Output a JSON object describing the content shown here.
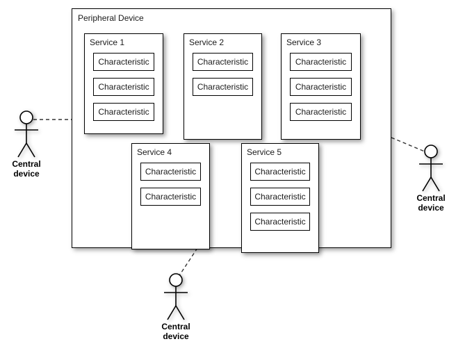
{
  "diagram": {
    "title": "Peripheral Device",
    "peripheral": {
      "label": "Peripheral Device",
      "services": [
        {
          "name": "Service 1",
          "characteristics": [
            "Characteristic",
            "Characteristic",
            "Characteristic"
          ]
        },
        {
          "name": "Service 2",
          "characteristics": [
            "Characteristic",
            "Characteristic"
          ]
        },
        {
          "name": "Service 3",
          "characteristics": [
            "Characteristic",
            "Characteristic",
            "Characteristic"
          ]
        },
        {
          "name": "Service 4",
          "characteristics": [
            "Characteristic",
            "Characteristic"
          ]
        },
        {
          "name": "Service 5",
          "characteristics": [
            "Characteristic",
            "Characteristic",
            "Characteristic"
          ]
        }
      ]
    },
    "actors": [
      {
        "id": "central-device-left",
        "line1": "Central",
        "line2": "device"
      },
      {
        "id": "central-device-right",
        "line1": "Central",
        "line2": "device"
      },
      {
        "id": "central-device-bottom",
        "line1": "Central",
        "line2": "device"
      }
    ],
    "colors": {
      "stroke": "#000000",
      "background": "#ffffff",
      "text": "#1a1a1a",
      "connector": "#333333"
    }
  }
}
